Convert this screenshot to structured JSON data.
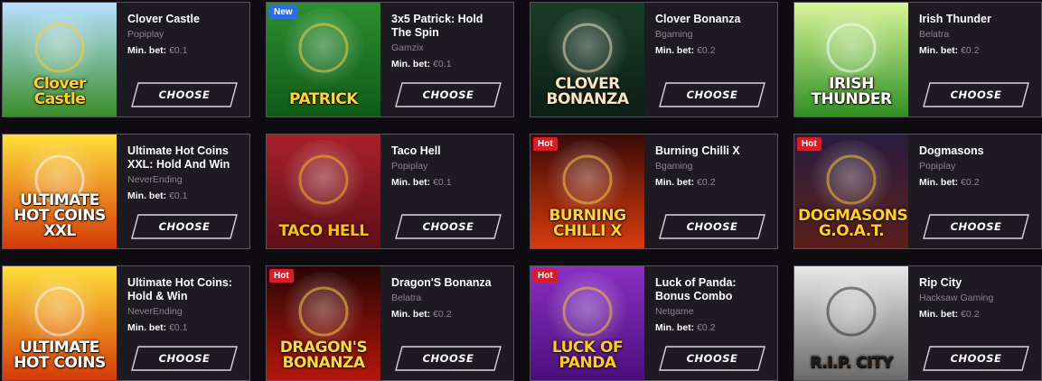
{
  "choose_label": "CHOOSE",
  "min_bet_label": "Min. bet:",
  "games": [
    {
      "title": "Clover Castle",
      "provider": "Popiplay",
      "min_bet": "€0.1",
      "badge": null,
      "art_text": "Clover Castle",
      "bg_top": "#b7e0ff",
      "bg_bottom": "#3b8d2a",
      "text_color": "#ffcf2a"
    },
    {
      "title": "3x5 Patrick: Hold The Spin",
      "provider": "Gamzix",
      "min_bet": "€0.1",
      "badge": "New",
      "badge_color": "#2d6fe0",
      "art_text": "PATRICK",
      "bg_top": "#2b8f2f",
      "bg_bottom": "#0f5a1a",
      "text_color": "#ffd43b"
    },
    {
      "title": "Clover Bonanza",
      "provider": "Bgaming",
      "min_bet": "€0.2",
      "badge": null,
      "art_text": "CLOVER BONANZA",
      "bg_top": "#1a3c28",
      "bg_bottom": "#0c1f14",
      "text_color": "#f3e7c7"
    },
    {
      "title": "Irish Thunder",
      "provider": "Belatra",
      "min_bet": "€0.2",
      "badge": null,
      "art_text": "IRISH THUNDER",
      "bg_top": "#d9f59a",
      "bg_bottom": "#2f8f22",
      "text_color": "#ffffff"
    },
    {
      "title": "Ultimate Hot Coins XXL: Hold And Win",
      "provider": "NeverEnding",
      "min_bet": "€0.1",
      "badge": null,
      "art_text": "ULTIMATE HOT COINS XXL",
      "bg_top": "#ffdf3a",
      "bg_bottom": "#d53a08",
      "text_color": "#ffffff"
    },
    {
      "title": "Taco Hell",
      "provider": "Popiplay",
      "min_bet": "€0.1",
      "badge": null,
      "art_text": "TACO HELL",
      "bg_top": "#a8202a",
      "bg_bottom": "#5d0f18",
      "text_color": "#ffbf1a"
    },
    {
      "title": "Burning Chilli X",
      "provider": "Bgaming",
      "min_bet": "€0.2",
      "badge": "Hot",
      "badge_color": "#d31f2c",
      "art_text": "BURNING CHILLI X",
      "bg_top": "#3b0a08",
      "bg_bottom": "#d83b0c",
      "text_color": "#ffd23a"
    },
    {
      "title": "Dogmasons",
      "provider": "Popiplay",
      "min_bet": "€0.2",
      "badge": "Hot",
      "badge_color": "#d31f2c",
      "art_text": "DOGMASONS G.O.A.T.",
      "bg_top": "#2a1c3f",
      "bg_bottom": "#5a1f1a",
      "text_color": "#ffce2b"
    },
    {
      "title": "Ultimate Hot Coins: Hold & Win",
      "provider": "NeverEnding",
      "min_bet": "€0.1",
      "badge": null,
      "art_text": "ULTIMATE HOT COINS",
      "bg_top": "#ffdf3a",
      "bg_bottom": "#d53a08",
      "text_color": "#ffffff"
    },
    {
      "title": "Dragon'S Bonanza",
      "provider": "Belatra",
      "min_bet": "€0.2",
      "badge": "Hot",
      "badge_color": "#d31f2c",
      "art_text": "DRAGON'S BONANZA",
      "bg_top": "#2a0504",
      "bg_bottom": "#b3170b",
      "text_color": "#ffd54a"
    },
    {
      "title": "Luck of Panda: Bonus Combo",
      "provider": "Netgame",
      "min_bet": "€0.2",
      "badge": "Hot",
      "badge_color": "#d31f2c",
      "art_text": "LUCK OF PANDA",
      "bg_top": "#8a2fc2",
      "bg_bottom": "#4a0f7a",
      "text_color": "#ffcb2a"
    },
    {
      "title": "Rip City",
      "provider": "Hacksaw Gaming",
      "min_bet": "€0.2",
      "badge": null,
      "art_text": "R.I.P. CITY",
      "bg_top": "#e8e8e8",
      "bg_bottom": "#6a6a6a",
      "text_color": "#1c1c1c"
    }
  ]
}
